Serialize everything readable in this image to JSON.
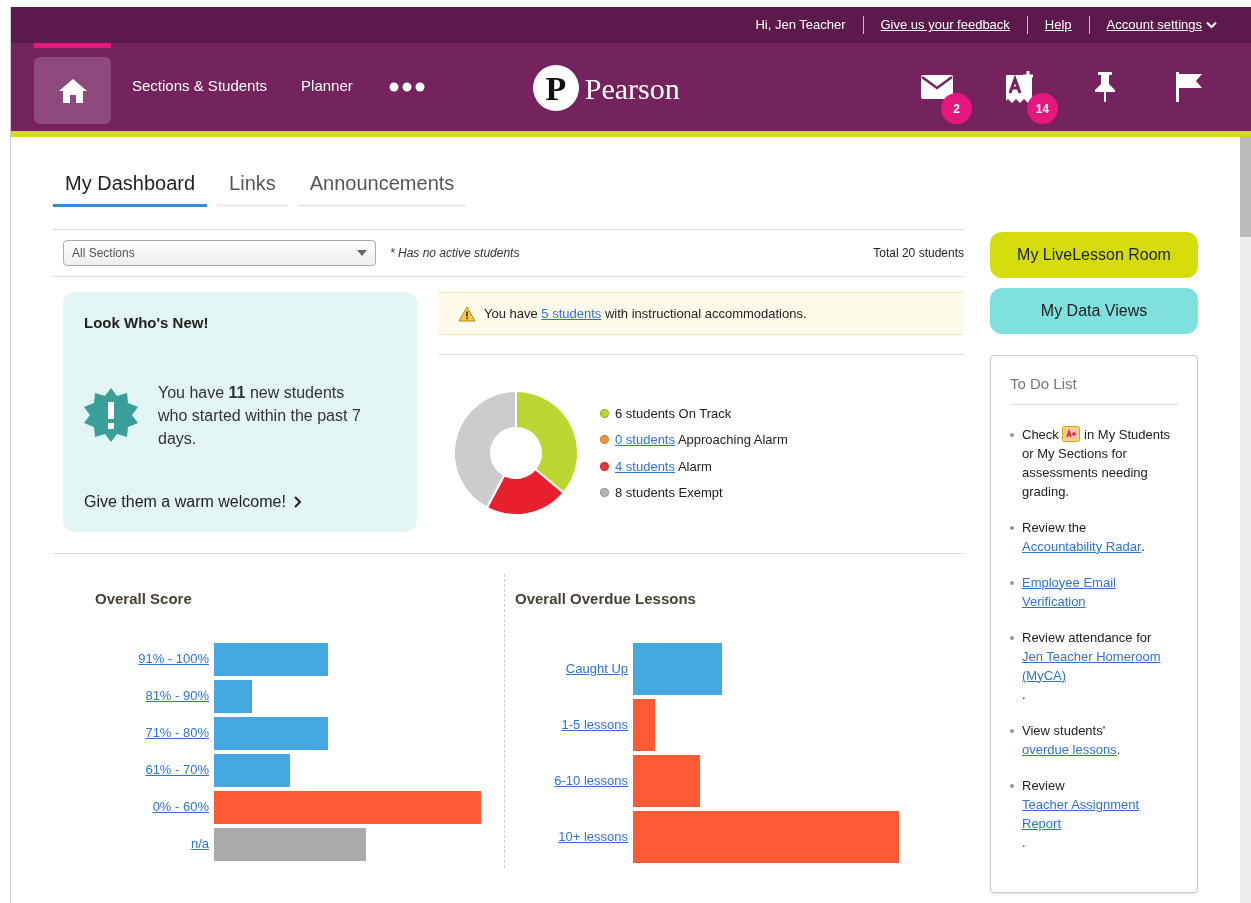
{
  "top_bar": {
    "greeting": "Hi, Jen Teacher",
    "links": [
      "Give us your feedback",
      "Help"
    ],
    "account": "Account settings"
  },
  "nav": {
    "items": [
      "Sections & Students",
      "Planner"
    ],
    "logo": {
      "mark": "P",
      "name": "Pearson"
    },
    "mail_badge": "2",
    "grades_badge": "14"
  },
  "tabs": [
    {
      "label": "My Dashboard",
      "selected": true
    },
    {
      "label": "Links",
      "selected": false
    },
    {
      "label": "Announcements",
      "selected": false
    }
  ],
  "filter": {
    "value": "All Sections",
    "note": "* Has no active students",
    "total": "Total 20 students"
  },
  "new_students": {
    "title": "Look Who's New!",
    "message": "You have **11** new students who started within the past 7 days.",
    "action": "Give them a warm welcome!"
  },
  "alert": [
    {
      "kind": "text",
      "text": "You have "
    },
    {
      "kind": "link",
      "text": "5 students"
    },
    {
      "kind": "text",
      "text": " with instructional accommodations."
    }
  ],
  "legend": [
    {
      "color": "#bcd631",
      "text": "6 students On Track"
    },
    {
      "color": "#f0953a",
      "link": "0 students",
      "text": " Approaching Alarm"
    },
    {
      "color": "#e8323c",
      "link": "4 students",
      "text": " Alarm"
    },
    {
      "color": "#b4b4b4",
      "text": "8 students Exempt"
    }
  ],
  "score_chart": {
    "title": "Overall Score",
    "bars": [
      {
        "label": "91% - 100%",
        "color": "#45a8e0"
      },
      {
        "label": "81% - 90%",
        "color": "#45a8e0"
      },
      {
        "label": "71% - 80%",
        "color": "#45a8e0"
      },
      {
        "label": "61% - 70%",
        "color": "#45a8e0"
      },
      {
        "label": "0% - 60%",
        "color": "#ff5a36"
      },
      {
        "label": "n/a",
        "color": "#aaaaaa"
      }
    ]
  },
  "overdue_chart": {
    "title": "Overall Overdue Lessons",
    "bars": [
      {
        "label": "Caught Up",
        "color": "#45a8e0"
      },
      {
        "label": "1-5 lessons",
        "color": "#ff5a36"
      },
      {
        "label": "6-10 lessons",
        "color": "#ff5a36"
      },
      {
        "label": "10+ lessons",
        "color": "#ff5a36"
      }
    ]
  },
  "side_buttons": [
    "My LiveLesson Room",
    "My Data Views"
  ],
  "todo": {
    "title": "To Do List",
    "items": [
      [
        {
          "kind": "text",
          "text": "Check "
        },
        {
          "kind": "icon"
        },
        {
          "kind": "text",
          "text": " in My Students or My Sections for assessments needing grading."
        }
      ],
      [
        {
          "kind": "text",
          "text": "Review the "
        },
        {
          "kind": "link",
          "text": "Accountability Radar"
        },
        {
          "kind": "text",
          "text": "."
        }
      ],
      [
        {
          "kind": "link",
          "text": "Employee Email Verification"
        }
      ],
      [
        {
          "kind": "text",
          "text": "Review attendance for "
        },
        {
          "kind": "link",
          "text": "Jen Teacher Homeroom (MyCA)"
        },
        {
          "kind": "text",
          "text": "."
        }
      ],
      [
        {
          "kind": "text",
          "text": "View students' "
        },
        {
          "kind": "link",
          "text": "overdue lessons"
        },
        {
          "kind": "text",
          "text": "."
        }
      ],
      [
        {
          "kind": "text",
          "text": "Review "
        },
        {
          "kind": "link",
          "text": "Teacher Assignment Report"
        },
        {
          "kind": "text",
          "text": "."
        }
      ]
    ]
  }
}
